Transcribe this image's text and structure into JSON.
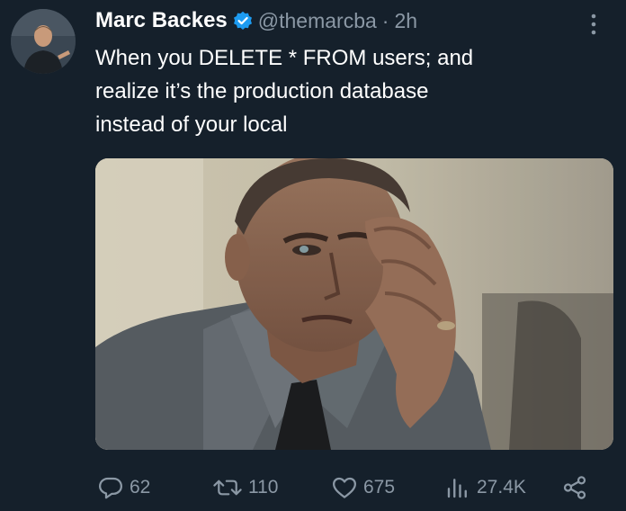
{
  "tweet": {
    "display_name": "Marc Backes",
    "handle": "@themarcba",
    "separator": "·",
    "time": "2h",
    "text_lines": [
      "When you DELETE * FROM users; and",
      "realize it’s the production database",
      "instead of your local"
    ]
  },
  "actions": {
    "replies": "62",
    "reposts": "110",
    "likes": "675",
    "views": "27.4K"
  },
  "colors": {
    "background": "#15202b",
    "text": "#ffffff",
    "secondary_text": "#8b98a5",
    "verified": "#1d9bf0"
  },
  "icons": [
    "verified-badge-icon",
    "more-options-icon",
    "reply-icon",
    "repost-icon",
    "like-icon",
    "views-icon",
    "share-icon"
  ]
}
